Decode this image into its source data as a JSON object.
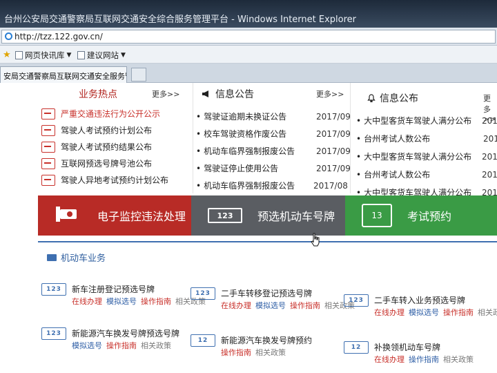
{
  "browser": {
    "window_title": "台州公安局交通警察局互联网交通安全综合服务管理平台 - Windows Internet Explorer",
    "address": "http://tzz.122.gov.cn/",
    "favorites": [
      {
        "label": "网页快讯库"
      },
      {
        "label": "建议网站"
      }
    ],
    "tab_title": "安局交通警察局互联网交通安全服务管..."
  },
  "hot": {
    "title": "业务热点",
    "more": "更多>>",
    "items": [
      {
        "label": "严重交通违法行为公开公示",
        "highlight": true
      },
      {
        "label": "驾驶人考试预约计划公布",
        "highlight": false
      },
      {
        "label": "驾驶人考试预约结果公布",
        "highlight": false
      },
      {
        "label": "互联网预选号牌号池公布",
        "highlight": false
      },
      {
        "label": "驾驶人异地考试预约计划公布",
        "highlight": false
      }
    ]
  },
  "notices": {
    "title": "信息公告",
    "more": "更多>>",
    "items": [
      {
        "label": "驾驶证逾期未换证公告",
        "date": "2017/09"
      },
      {
        "label": "校车驾驶资格作废公告",
        "date": "2017/09"
      },
      {
        "label": "机动车临界强制报废公告",
        "date": "2017/09"
      },
      {
        "label": "驾驶证停止使用公告",
        "date": "2017/09"
      },
      {
        "label": "机动车临界强制报废公告",
        "date": "2017/08"
      }
    ]
  },
  "publish": {
    "title": "信息公布",
    "more": "更多>>",
    "items": [
      {
        "label": "大中型客货车驾驶人满分公布",
        "date": "201"
      },
      {
        "label": "台州考试人数公布",
        "date": "201"
      },
      {
        "label": "大中型客货车驾驶人满分公布",
        "date": "201"
      },
      {
        "label": "台州考试人数公布",
        "date": "201"
      },
      {
        "label": "大中型客货车驾驶人满分公布",
        "date": "201"
      }
    ]
  },
  "big_buttons": {
    "violation": "电子监控违法处理",
    "plate": "预选机动车号牌",
    "plate_icon": "123",
    "exam": "考试预约",
    "exam_icon": "13"
  },
  "vehicle": {
    "section_title": "机动车业务",
    "services": [
      {
        "icon": "123",
        "name": "新车注册登记预选号牌",
        "links": [
          "在线办理",
          "模拟选号",
          "操作指南",
          "相关政策"
        ]
      },
      {
        "icon": "123",
        "name": "二手车转移登记预选号牌",
        "links": [
          "在线办理",
          "模拟选号",
          "操作指南",
          "相关政策"
        ]
      },
      {
        "icon": "123",
        "name": "二手车转入业务预选号牌",
        "links": [
          "在线办理",
          "模拟选号",
          "操作指南",
          "相关政策"
        ]
      },
      {
        "icon": "123",
        "name": "新能源汽车换发号牌预选号牌",
        "links": [
          "模拟选号",
          "操作指南",
          "相关政策"
        ]
      },
      {
        "icon": "12",
        "name": "新能源汽车换发号牌预约",
        "links": [
          "操作指南",
          "相关政策"
        ]
      },
      {
        "icon": "12",
        "name": "补换领机动车号牌",
        "links": [
          "在线办理",
          "操作指南",
          "相关政策"
        ]
      }
    ]
  }
}
